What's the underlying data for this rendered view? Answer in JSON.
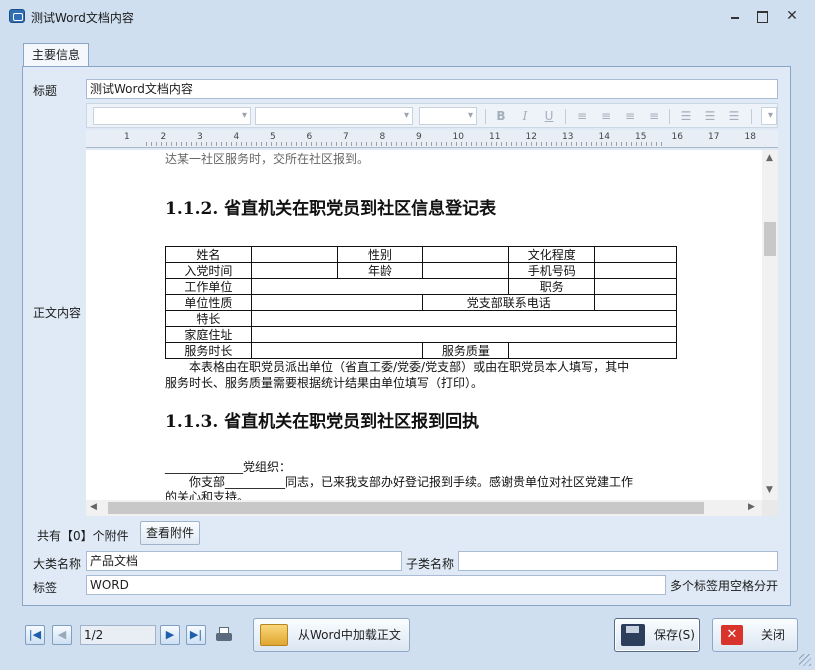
{
  "window": {
    "title": "测试Word文档内容"
  },
  "tabs": [
    {
      "label": "主要信息"
    }
  ],
  "form": {
    "title_label": "标题",
    "title_value": "测试Word文档内容",
    "content_label": "正文内容",
    "attachment_prefix": "共有【0】个附件",
    "view_attachments_label": "查看附件",
    "category_label": "大类名称",
    "category_value": "产品文档",
    "subcategory_label": "子类名称",
    "subcategory_value": "",
    "tags_label": "标签",
    "tags_value": "WORD",
    "tags_hint": "多个标签用空格分开"
  },
  "ruler": {
    "ticks": [
      "1",
      "2",
      "3",
      "4",
      "5",
      "6",
      "7",
      "8",
      "9",
      "10",
      "11",
      "12",
      "13",
      "14",
      "15",
      "16",
      "17",
      "18"
    ]
  },
  "document": {
    "top_para": "达某一社区服务时，交所在社区报到。",
    "heading_1": "1.1.2.  省直机关在职党员到社区信息登记表",
    "table": {
      "r1": [
        "姓名",
        "",
        "性别",
        "",
        "文化程度",
        ""
      ],
      "r2": [
        "入党时间",
        "",
        "年龄",
        "",
        "手机号码",
        ""
      ],
      "r3": [
        "工作单位",
        "",
        "职务",
        ""
      ],
      "r4": [
        "单位性质",
        "",
        "党支部联系电话",
        ""
      ],
      "r5": [
        "特长",
        ""
      ],
      "r6": [
        "家庭住址",
        ""
      ],
      "r7": [
        "服务时长",
        "",
        "服务质量",
        ""
      ]
    },
    "note_line1": "本表格由在职党员派出单位（省直工委/党委/党支部）或由在职党员本人填写，其中",
    "note_line2": "服务时长、服务质量需要根据统计结果由单位填写（打印）。",
    "heading_2": "1.1.3.  省直机关在职党员到社区报到回执",
    "receipt_line1": "_____________党组织：",
    "receipt_line2": "你支部__________同志，已来我支部办好登记报到手续。感谢贵单位对社区党建工作",
    "receipt_line3": "的关心和支持。"
  },
  "footer": {
    "page_indicator": "1/2",
    "load_word_label": "从Word中加载正文",
    "save_label": "保存(S)",
    "close_label": "关闭"
  }
}
